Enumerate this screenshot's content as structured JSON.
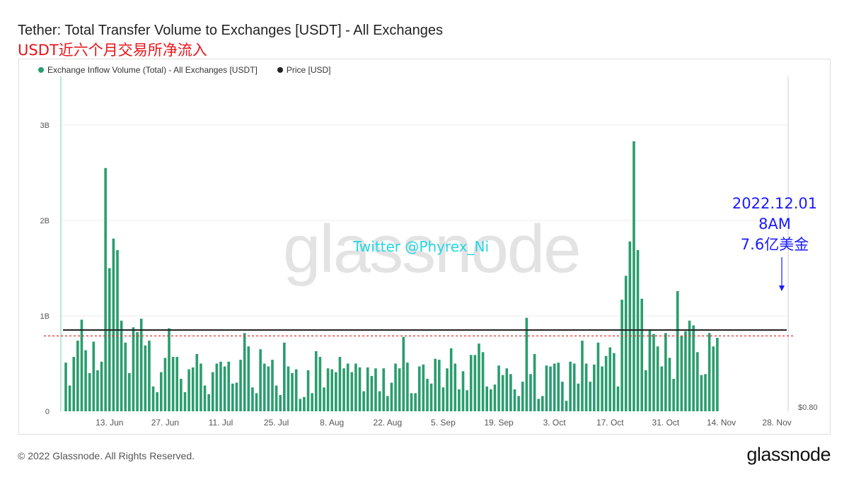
{
  "header": {
    "title": "Tether: Total Transfer Volume to Exchanges [USDT] - All Exchanges",
    "subtitle": "USDT近六个月交易所净流入"
  },
  "watermark": "glassnode",
  "overlay": {
    "twitter_handle": "Twitter @Phyrex_Ni",
    "note_lines": [
      "2022.12.01",
      "8AM",
      "7.6亿美金"
    ]
  },
  "footer": {
    "copyright": "© 2022 Glassnode. All Rights Reserved.",
    "brand": "glassnode"
  },
  "colors": {
    "bar": "#2a9d6e",
    "price_line": "#222222",
    "reference_line": "#e03030",
    "annotation": "#1a1aff",
    "twitter_text": "#25d6e3"
  },
  "chart_data": {
    "type": "bar",
    "title": "Tether: Total Transfer Volume to Exchanges [USDT] - All Exchanges",
    "series": [
      {
        "name": "Exchange Inflow Volume (Total) - All Exchanges [USDT]",
        "type": "bar",
        "unit": "USDT",
        "values": [
          510000000,
          270000000,
          570000000,
          740000000,
          960000000,
          640000000,
          400000000,
          730000000,
          430000000,
          520000000,
          2550000000,
          1500000000,
          1810000000,
          1690000000,
          950000000,
          720000000,
          400000000,
          880000000,
          830000000,
          970000000,
          690000000,
          740000000,
          260000000,
          200000000,
          410000000,
          560000000,
          870000000,
          570000000,
          570000000,
          340000000,
          200000000,
          440000000,
          460000000,
          600000000,
          500000000,
          270000000,
          180000000,
          410000000,
          500000000,
          520000000,
          470000000,
          520000000,
          290000000,
          300000000,
          540000000,
          820000000,
          680000000,
          250000000,
          190000000,
          650000000,
          500000000,
          470000000,
          540000000,
          270000000,
          170000000,
          720000000,
          470000000,
          400000000,
          440000000,
          130000000,
          150000000,
          430000000,
          190000000,
          630000000,
          570000000,
          250000000,
          450000000,
          440000000,
          410000000,
          570000000,
          450000000,
          500000000,
          410000000,
          500000000,
          460000000,
          210000000,
          460000000,
          370000000,
          450000000,
          210000000,
          450000000,
          160000000,
          300000000,
          500000000,
          450000000,
          780000000,
          510000000,
          190000000,
          190000000,
          470000000,
          490000000,
          340000000,
          290000000,
          550000000,
          540000000,
          250000000,
          450000000,
          660000000,
          500000000,
          230000000,
          420000000,
          220000000,
          590000000,
          590000000,
          710000000,
          620000000,
          260000000,
          230000000,
          280000000,
          480000000,
          380000000,
          450000000,
          390000000,
          230000000,
          160000000,
          310000000,
          980000000,
          390000000,
          600000000,
          130000000,
          160000000,
          480000000,
          470000000,
          500000000,
          510000000,
          310000000,
          110000000,
          520000000,
          500000000,
          290000000,
          740000000,
          500000000,
          310000000,
          490000000,
          720000000,
          470000000,
          580000000,
          670000000,
          610000000,
          260000000,
          1170000000,
          1420000000,
          1780000000,
          2830000000,
          1690000000,
          1180000000,
          430000000,
          860000000,
          810000000,
          680000000,
          470000000,
          820000000,
          560000000,
          340000000,
          1260000000,
          790000000,
          840000000,
          950000000,
          900000000,
          620000000,
          380000000,
          390000000,
          820000000,
          680000000,
          770000000
        ],
        "max_shown": 2830000000
      },
      {
        "name": "Price [USD]",
        "type": "line",
        "unit": "USD",
        "value": 1.0
      }
    ],
    "x_tick_labels": [
      "13. Jun",
      "27. Jun",
      "11. Jul",
      "25. Jul",
      "8. Aug",
      "22. Aug",
      "5. Sep",
      "19. Sep",
      "3. Oct",
      "17. Oct",
      "31. Oct",
      "14. Nov",
      "28. Nov"
    ],
    "x_tick_bar_index": [
      11,
      25,
      39,
      53,
      67,
      81,
      95,
      109,
      123,
      137,
      151,
      165,
      179
    ],
    "y_left": {
      "ticks": [
        0,
        1000000000,
        2000000000,
        3000000000
      ],
      "tick_labels": [
        "0",
        "1B",
        "2B",
        "3B"
      ],
      "ylim": [
        0,
        3000000000
      ]
    },
    "y_right": {
      "tick_labels": [
        "$0.80"
      ]
    },
    "reference_line": {
      "value": 790000000,
      "style": "dashed"
    },
    "grid": true,
    "legend_position": "top-left"
  }
}
